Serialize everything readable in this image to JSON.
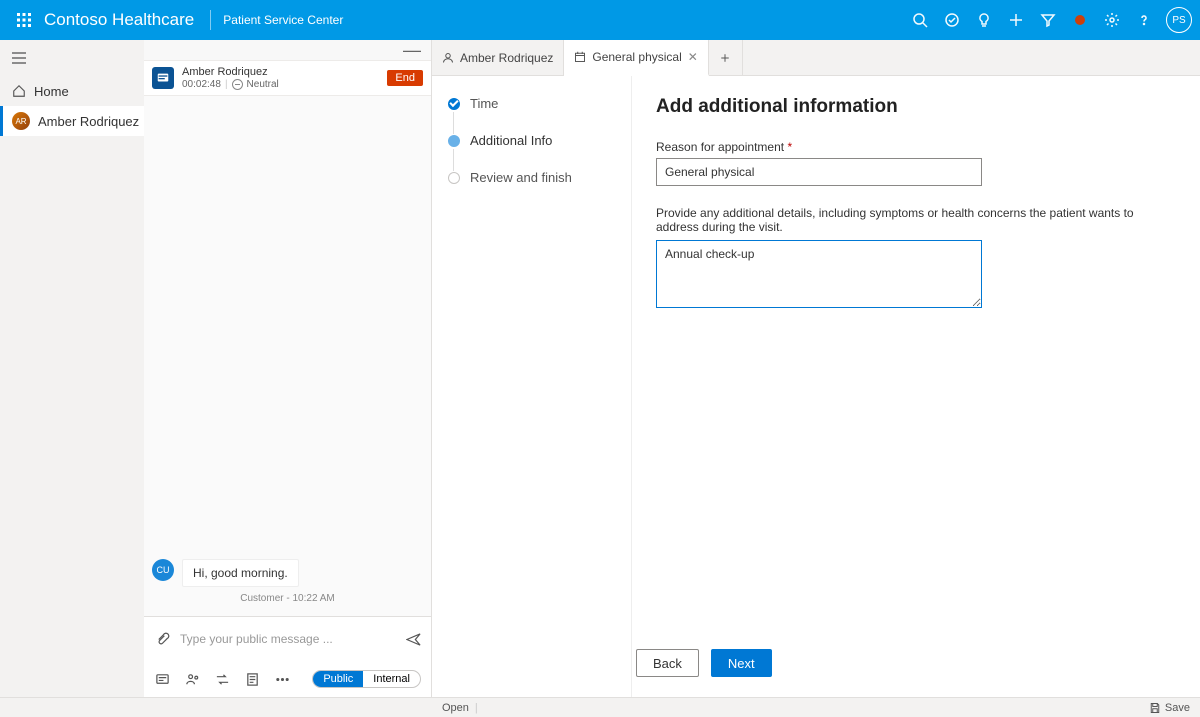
{
  "header": {
    "brand": "Contoso Healthcare",
    "sub": "Patient Service Center",
    "avatar_initials": "PS"
  },
  "nav": {
    "home": "Home",
    "active_item": "Amber Rodriquez",
    "active_initials": "AR"
  },
  "conversation": {
    "name": "Amber Rodriquez",
    "timer": "00:02:48",
    "sentiment": "Neutral",
    "end_label": "End",
    "message_avatar": "CU",
    "message_text": "Hi, good morning.",
    "message_meta": "Customer - 10:22 AM",
    "compose_placeholder": "Type your public message ...",
    "toggle_public": "Public",
    "toggle_internal": "Internal"
  },
  "tabs": {
    "t1": "Amber Rodriquez",
    "t2": "General physical"
  },
  "steps": {
    "s1": "Time",
    "s2": "Additional Info",
    "s3": "Review and finish"
  },
  "form": {
    "title": "Add additional information",
    "reason_label": "Reason for appointment",
    "reason_value": "General physical",
    "details_label": "Provide any additional details, including symptoms or health concerns the patient wants to address during the visit.",
    "details_value": "Annual check-up",
    "back": "Back",
    "next": "Next"
  },
  "status": {
    "open": "Open",
    "save": "Save"
  }
}
